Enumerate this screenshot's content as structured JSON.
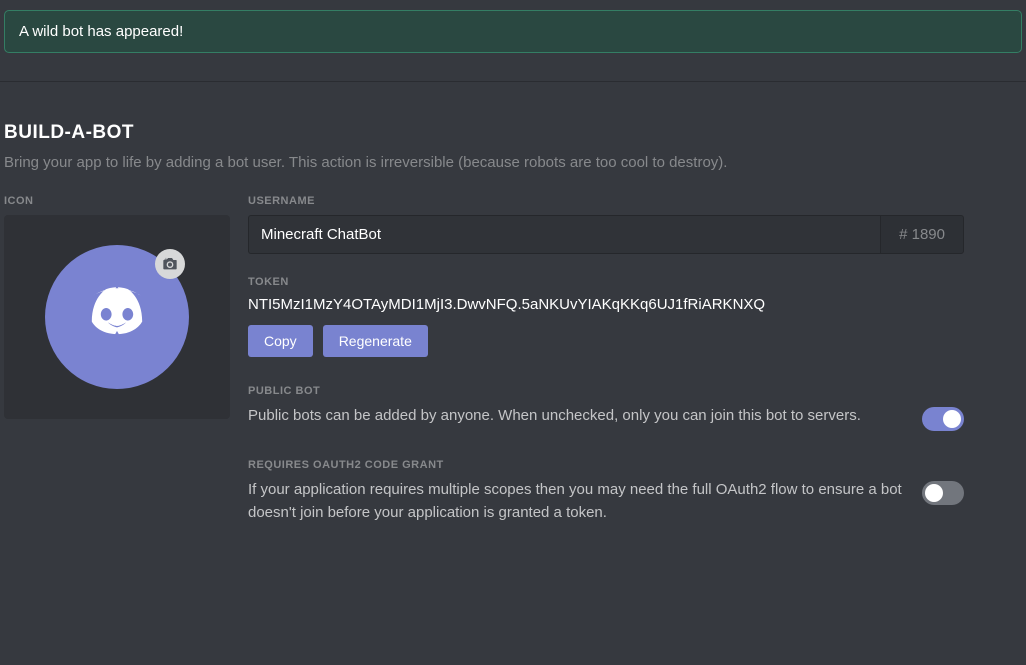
{
  "notification": {
    "message": "A wild bot has appeared!"
  },
  "page": {
    "title": "BUILD-A-BOT",
    "subtitle": "Bring your app to life by adding a bot user. This action is irreversible (because robots are too cool to destroy)."
  },
  "icon": {
    "label": "ICON"
  },
  "username": {
    "label": "USERNAME",
    "value": "Minecraft ChatBot",
    "discriminator": "# 1890"
  },
  "token": {
    "label": "TOKEN",
    "value": "NTI5MzI1MzY4OTAyMDI1MjI3.DwvNFQ.5aNKUvYIAKqKKq6UJ1fRiARKNXQ",
    "copy_label": "Copy",
    "regenerate_label": "Regenerate"
  },
  "public_bot": {
    "label": "PUBLIC BOT",
    "description": "Public bots can be added by anyone. When unchecked, only you can join this bot to servers.",
    "enabled": true
  },
  "oauth2": {
    "label": "REQUIRES OAUTH2 CODE GRANT",
    "description": "If your application requires multiple scopes then you may need the full OAuth2 flow to ensure a bot doesn't join before your application is granted a token.",
    "enabled": false
  }
}
